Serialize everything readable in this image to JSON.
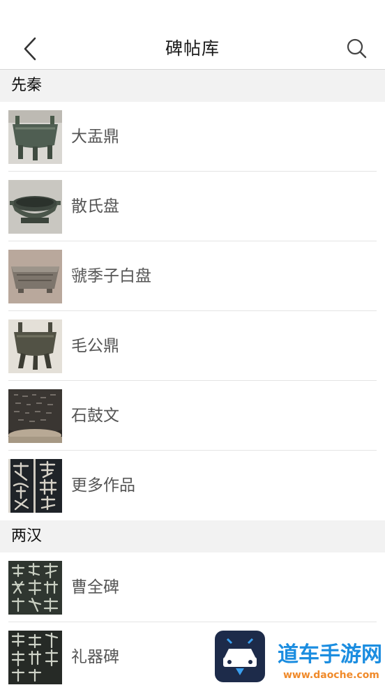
{
  "header": {
    "title": "碑帖库"
  },
  "sections": [
    {
      "title": "先秦",
      "items": [
        {
          "label": "大盂鼎"
        },
        {
          "label": "散氏盘"
        },
        {
          "label": "虢季子白盘"
        },
        {
          "label": "毛公鼎"
        },
        {
          "label": "石鼓文"
        },
        {
          "label": "更多作品"
        }
      ]
    },
    {
      "title": "两汉",
      "items": [
        {
          "label": "曹全碑"
        },
        {
          "label": "礼器碑"
        }
      ]
    }
  ],
  "watermark": {
    "name": "道车手游网",
    "url": "www.daoche.com"
  },
  "colors": {
    "section_bg": "#f2f2f2",
    "divider": "#e4e4e4",
    "label_text": "#555555",
    "watermark_blue": "#1b8de0"
  }
}
